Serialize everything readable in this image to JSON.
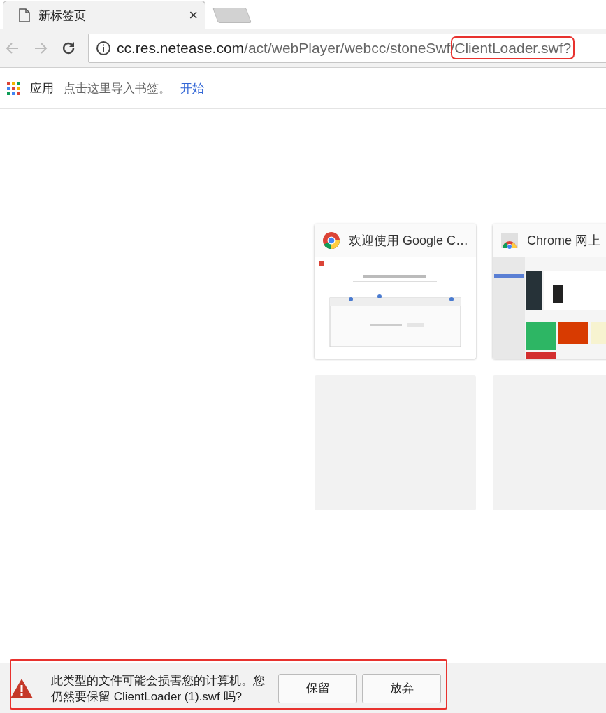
{
  "tabs": [
    {
      "kind": "tab",
      "title": "新标签页",
      "close": "×",
      "selected": true
    },
    {
      "kind": "new_tab",
      "selected": false
    }
  ],
  "address_bar": {
    "host": "cc.res.netease.com",
    "path": "/act/webPlayer/webcc/stoneSwf/",
    "file": "ClientLoader.swf?",
    "file_highlighted": true
  },
  "bookmarks_bar": {
    "apps": "应用",
    "hint": "点击这里导入书签。",
    "link": "开始"
  },
  "tiles": [
    {
      "kind": "site",
      "title": "欢迎使用 Google C…"
    },
    {
      "kind": "site",
      "title": "Chrome 网上"
    },
    {
      "kind": "empty"
    },
    {
      "kind": "empty"
    }
  ],
  "download_bar": {
    "message": "此类型的文件可能会损害您的计算机。您仍然要保留 ClientLoader (1).swf 吗?",
    "buttons": [
      "保留",
      "放弃"
    ],
    "highlighted": true
  }
}
